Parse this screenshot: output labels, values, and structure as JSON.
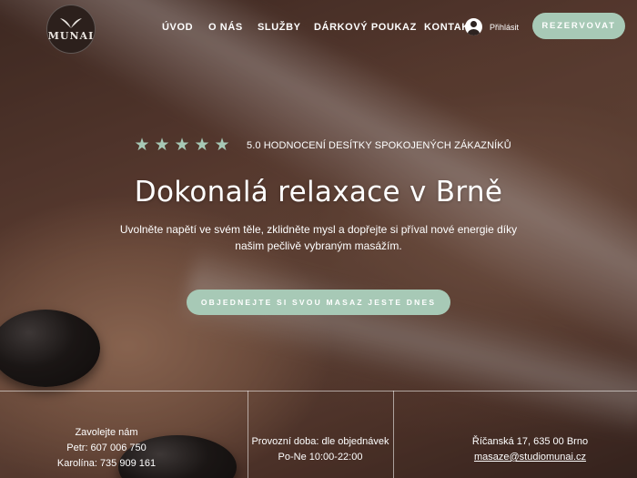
{
  "brand": {
    "logo_text": "MUNAI"
  },
  "nav": {
    "items": [
      "ÚVOD",
      "O NÁS",
      "SLUŽBY",
      "DÁRKOVÝ POUKAZ",
      "KONTAKT"
    ],
    "login_label": "Přihlásit",
    "reserve_label": "REZERVOVAT"
  },
  "hero": {
    "stars": [
      "★",
      "★",
      "★",
      "★",
      "★"
    ],
    "rating": 5,
    "rating_text": "5.0 HODNOCENÍ DESÍTKY SPOKOJENÝCH ZÁKAZNÍKŮ",
    "title": "Dokonalá relaxace v Brně",
    "subtitle": "Uvolněte napětí ve svém těle, zklidněte mysl a dopřejte si příval nové energie díky našim pečlivě vybraným masážím.",
    "cta_label": "OBJEDNEJTE SI SVOU MASAZ JESTE DNES"
  },
  "info": {
    "contact_heading": "Zavolejte nám",
    "phone_petr": "Petr: 607 006 750",
    "phone_karolina": "Karolína: 735 909 161",
    "hours_label": "Provozní doba: dle objednávek",
    "hours_value": "Po-Ne 10:00-22:00",
    "address": "Říčanská 17, 635 00 Brno",
    "email": "masaze@studiomunai.cz"
  },
  "colors": {
    "accent": "#a7c9b6",
    "logo_bg": "#2c201c"
  }
}
